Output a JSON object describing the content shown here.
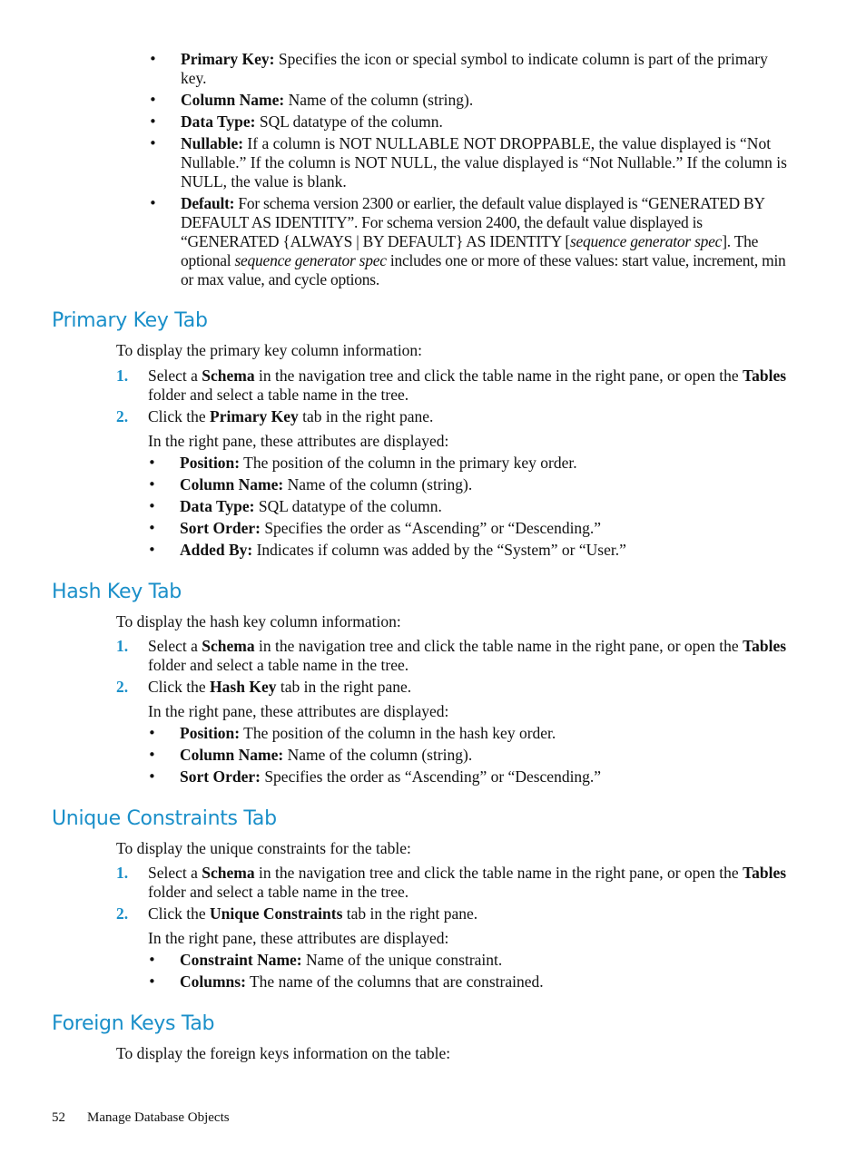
{
  "top_bullets": [
    {
      "label": "Primary Key:",
      "text": " Specifies the icon or special symbol to indicate column is part of the primary key."
    },
    {
      "label": "Column Name:",
      "text": " Name of the column (string)."
    },
    {
      "label": "Data Type:",
      "text": " SQL datatype of the column."
    },
    {
      "label": "Nullable:",
      "text": " If a column is NOT NULLABLE NOT DROPPABLE, the value displayed is “Not Nullable.” If the column is NOT NULL, the value displayed is “Not Nullable.” If the column is NULL, the value is blank."
    },
    {
      "label": "Default:",
      "text_parts": [
        " For schema version 2300 or earlier, the default value displayed is “GENERATED BY DEFAULT AS IDENTITY”. For schema version 2400, the default value displayed is “GENERATED {ALWAYS | BY DEFAULT} AS IDENTITY [",
        "sequence generator spec",
        "]. The optional ",
        "sequence generator spec",
        " includes one or more of these values: start value, increment, min or max value, and cycle options."
      ]
    }
  ],
  "sections": [
    {
      "heading": "Primary Key Tab",
      "intro": "To display the primary key column information:",
      "steps": [
        {
          "num": "1.",
          "parts": [
            "Select a ",
            "Schema",
            " in the navigation tree and click the table name in the right pane, or open the ",
            "Tables",
            " folder and select a table name in the tree."
          ]
        },
        {
          "num": "2.",
          "parts": [
            "Click the ",
            "Primary Key",
            " tab in the right pane."
          ]
        }
      ],
      "sub_intro": "In the right pane, these attributes are displayed:",
      "attributes": [
        {
          "label": "Position:",
          "text": " The position of the column in the primary key order."
        },
        {
          "label": "Column Name:",
          "text": " Name of the column (string)."
        },
        {
          "label": "Data Type:",
          "text": " SQL datatype of the column."
        },
        {
          "label": "Sort Order:",
          "text": " Specifies the order as “Ascending” or “Descending.”"
        },
        {
          "label": "Added By:",
          "text": " Indicates if column was added by the “System” or “User.”"
        }
      ]
    },
    {
      "heading": "Hash Key Tab",
      "intro": "To display the hash key column information:",
      "steps": [
        {
          "num": "1.",
          "parts": [
            "Select a ",
            "Schema",
            " in the navigation tree and click the table name in the right pane, or open the ",
            "Tables",
            " folder and select a table name in the tree."
          ]
        },
        {
          "num": "2.",
          "parts": [
            "Click the ",
            "Hash Key",
            " tab in the right pane."
          ]
        }
      ],
      "sub_intro": "In the right pane, these attributes are displayed:",
      "attributes": [
        {
          "label": "Position:",
          "text": " The position of the column in the hash key order."
        },
        {
          "label": "Column Name:",
          "text": " Name of the column (string)."
        },
        {
          "label": "Sort Order:",
          "text": " Specifies the order as “Ascending” or “Descending.”"
        }
      ]
    },
    {
      "heading": "Unique Constraints Tab",
      "intro": "To display the unique constraints for the table:",
      "steps": [
        {
          "num": "1.",
          "parts": [
            "Select a ",
            "Schema",
            " in the navigation tree and click the table name in the right pane, or open the ",
            "Tables",
            " folder and select a table name in the tree."
          ]
        },
        {
          "num": "2.",
          "parts": [
            "Click the ",
            "Unique Constraints",
            " tab in the right pane."
          ]
        }
      ],
      "sub_intro": "In the right pane, these attributes are displayed:",
      "attributes": [
        {
          "label": "Constraint Name:",
          "text": " Name of the unique constraint."
        },
        {
          "label": "Columns:",
          "text": " The name of the columns that are constrained."
        }
      ]
    },
    {
      "heading": "Foreign Keys Tab",
      "intro": "To display the foreign keys information on the table:"
    }
  ],
  "footer": {
    "page_number": "52",
    "chapter_title": "Manage Database Objects"
  },
  "colors": {
    "heading": "#1a8fc9",
    "step_number": "#1a8fc9",
    "body_text": "#111111"
  }
}
